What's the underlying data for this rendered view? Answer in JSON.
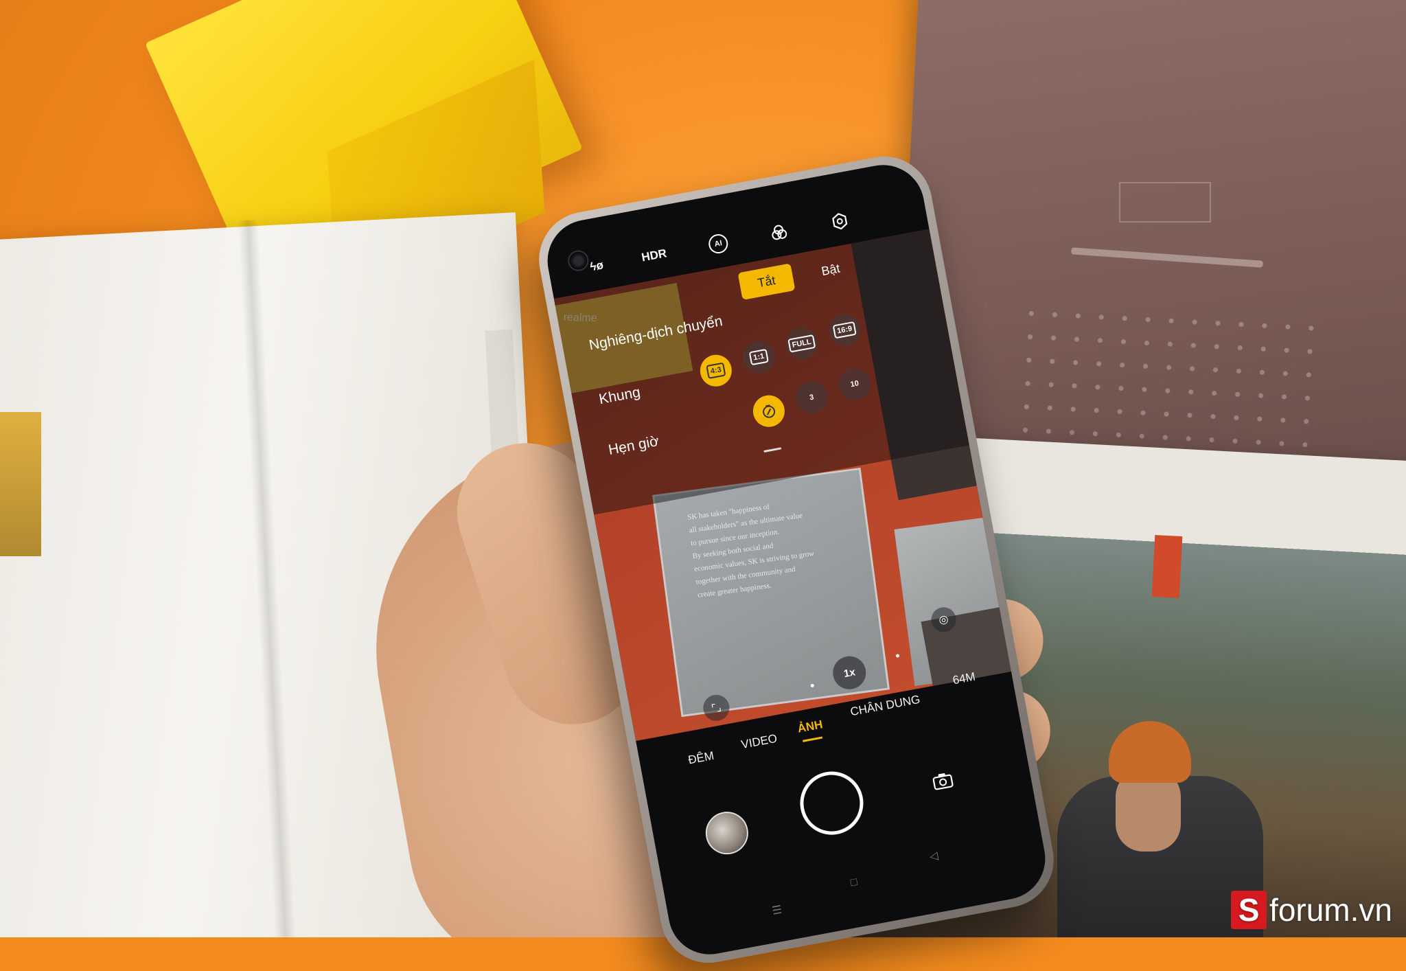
{
  "camera": {
    "topbar": {
      "flash_label": "ϟø",
      "hdr_label": "HDR",
      "ai_label": "AI"
    },
    "panel": {
      "rows": {
        "tilt_shift": "Nghiêng-dịch chuyển",
        "frame": "Khung",
        "timer": "Hẹn giờ"
      },
      "toggle": {
        "off": "Tắt",
        "on": "Bật",
        "selected": "Tắt"
      },
      "ratios": [
        "4:3",
        "1:1",
        "FULL",
        "16:9"
      ],
      "timers": [
        "3",
        "10"
      ]
    },
    "zoom_label": "1x",
    "modes": [
      "ĐÊM",
      "VIDEO",
      "ẢNH",
      "CHÂN DUNG",
      "64M"
    ],
    "active_mode": "ẢNH",
    "accent": "#f5b800"
  },
  "scene": {
    "phone_brand_text": "realme",
    "paper_text": [
      "SK has taken \"happiness of",
      "all stakeholders\" as the ultimate value",
      "to pursue since our inception.",
      "By seeking both social and",
      "economic values, SK is striving to grow",
      "together with the community and",
      "create greater happiness."
    ]
  },
  "watermark": {
    "logo_letter": "S",
    "text": "forum.vn",
    "color": "#d71920"
  }
}
